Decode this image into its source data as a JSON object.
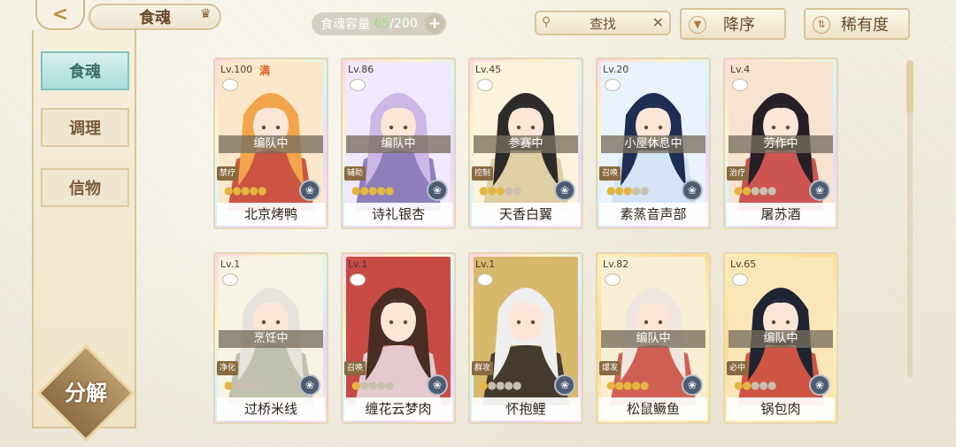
{
  "header": {
    "back_icon": "back-arrow-icon",
    "tab_title": "食魂",
    "capacity_label": "食魂容量",
    "capacity_current": "65",
    "capacity_total": "/200",
    "capacity_add": "+",
    "search_label": "查找",
    "search_clear": "✕",
    "sort_order_label": "降序",
    "sort_key_label": "稀有度"
  },
  "sidebar": {
    "items": [
      {
        "label": "食魂",
        "active": true
      },
      {
        "label": "调理",
        "active": false
      },
      {
        "label": "信物",
        "active": false
      }
    ],
    "decompose_label": "分解"
  },
  "cards": [
    {
      "level": "Lv.100",
      "max": "满",
      "status": "编队中",
      "role": "禁疗",
      "stars": 5,
      "name": "北京烤鸭",
      "element": "❀",
      "palette": [
        "#f2a54a",
        "#c23b2a",
        "#fbe7c9"
      ]
    },
    {
      "level": "Lv.86",
      "status": "编队中",
      "role": "辅助",
      "stars": 5,
      "name": "诗礼银杏",
      "element": "❀",
      "palette": [
        "#cdb7e6",
        "#7c6bb0",
        "#f1e9ff"
      ]
    },
    {
      "level": "Lv.45",
      "status": "参赛中",
      "role": "控制",
      "stars": 3,
      "name": "天香白翼",
      "element": "❀",
      "palette": [
        "#2d2a2a",
        "#d9c89a",
        "#fbf3dc"
      ]
    },
    {
      "level": "Lv.20",
      "status": "小屋休息中",
      "role": "召唤",
      "stars": 3,
      "name": "素蒸音声部",
      "element": "❀",
      "palette": [
        "#1e2e52",
        "#cfe0f3",
        "#eaf3fc"
      ]
    },
    {
      "level": "Lv.4",
      "status": "劳作中",
      "role": "治疗",
      "stars": 2,
      "name": "屠苏酒",
      "element": "❀",
      "palette": [
        "#262026",
        "#c43b3b",
        "#f6e3d0"
      ]
    },
    {
      "level": "Lv.1",
      "status": "烹饪中",
      "role": "净化",
      "stars": 1,
      "name": "过桥米线",
      "element": "❀",
      "palette": [
        "#e6e4dc",
        "#b7b7a4",
        "#f7f4e6"
      ]
    },
    {
      "level": "Lv.1",
      "status": "",
      "role": "召唤",
      "stars": 1,
      "name": "缠花云梦肉",
      "element": "❀",
      "palette": [
        "#4a2d22",
        "#e9e1e6",
        "#c84a45"
      ]
    },
    {
      "level": "Lv.1",
      "status": "",
      "role": "群攻",
      "stars": 1,
      "name": "怀抱鲤",
      "element": "❀",
      "palette": [
        "#efefef",
        "#2a2422",
        "#d8b86b"
      ]
    },
    {
      "level": "Lv.82",
      "status": "编队中",
      "role": "爆发",
      "stars": 5,
      "name": "松鼠鳜鱼",
      "element": "❀",
      "palette": [
        "#f0e6e0",
        "#c9463c",
        "#f8efd5"
      ]
    },
    {
      "level": "Lv.65",
      "status": "编队中",
      "role": "必中",
      "stars": 2,
      "name": "锅包肉",
      "element": "❀",
      "palette": [
        "#1f2433",
        "#c63b2f",
        "#fbe6b8"
      ]
    }
  ],
  "colors": {
    "accent": "#cfb98a",
    "active_tab": "#a9ddd8",
    "star_on": "#e4b640"
  }
}
